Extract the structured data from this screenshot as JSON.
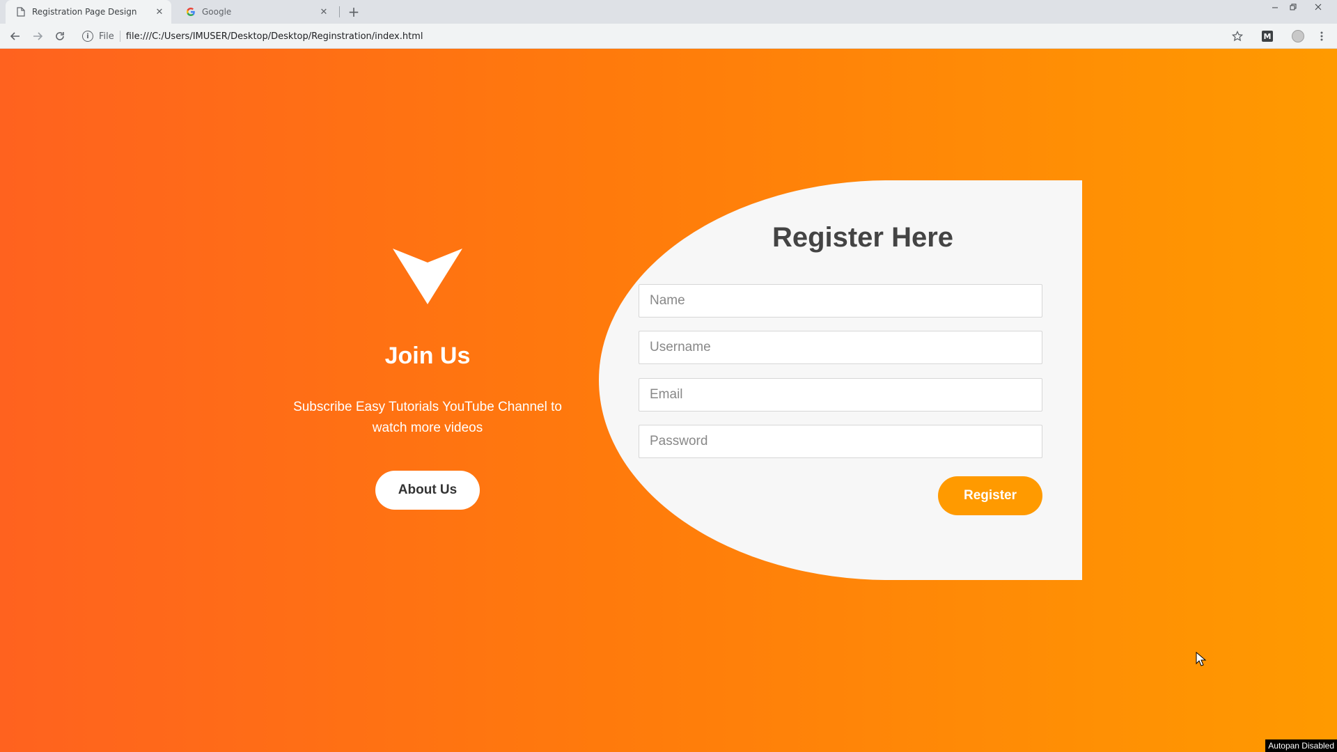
{
  "browser": {
    "tabs": [
      {
        "title": "Registration Page Design",
        "active": true,
        "icon": "document-icon"
      },
      {
        "title": "Google",
        "active": false,
        "icon": "google-icon"
      }
    ],
    "new_tab_label": "+",
    "address": {
      "scheme_label": "File",
      "url": "file:///C:/Users/IMUSER/Desktop/Desktop/Reginstration/index.html"
    },
    "extension_label": "M"
  },
  "left_panel": {
    "title": "Join Us",
    "description": "Subscribe Easy Tutorials YouTube Channel to watch more videos",
    "about_button": "About Us"
  },
  "form": {
    "title": "Register Here",
    "fields": [
      {
        "placeholder": "Name",
        "value": ""
      },
      {
        "placeholder": "Username",
        "value": ""
      },
      {
        "placeholder": "Email",
        "value": ""
      },
      {
        "placeholder": "Password",
        "value": ""
      }
    ],
    "submit_label": "Register"
  },
  "status_tag": "Autopan Disabled",
  "colors": {
    "gradient_start": "#ff621f",
    "gradient_end": "#ff9a00",
    "card_bg": "#f7f7f7",
    "accent": "#ff9a00"
  }
}
